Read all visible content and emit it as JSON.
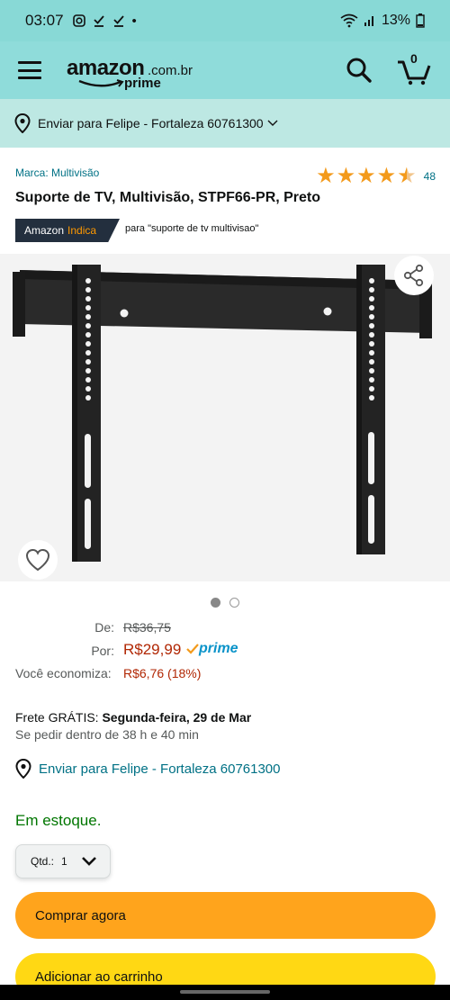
{
  "status_bar": {
    "time": "03:07",
    "icons": [
      "instagram-icon",
      "download-done-icon",
      "download-done-icon",
      "dot"
    ],
    "battery": "13%"
  },
  "header": {
    "logo_word": "amazon",
    "logo_tld": ".com.br",
    "logo_prime": "prime",
    "cart_count": "0"
  },
  "delivery_bar": {
    "text": "Enviar para Felipe - Fortaleza 60761300"
  },
  "product": {
    "brand": "Marca: Multivisão",
    "rating_value": 4.5,
    "rating_count": "48",
    "title": "Suporte de TV, Multivisão, STPF66-PR, Preto",
    "badge_amazon": "Amazon",
    "badge_indica": "Indica",
    "badge_query": "para \"suporte de tv multivisao\"",
    "carousel_total": 2,
    "carousel_active": 1
  },
  "pricing": {
    "de_label": "De:",
    "de_value": "R$36,75",
    "por_label": "Por:",
    "por_value": "R$29,99",
    "prime_label": "prime",
    "save_label": "Você economiza:",
    "save_value": "R$6,76 (18%)"
  },
  "delivery": {
    "frete_prefix": "Frete GRÁTIS:",
    "frete_date": "Segunda-feira, 29 de Mar",
    "pedir": "Se pedir dentro de 38 h e 40 min",
    "ship_to": "Enviar para Felipe - Fortaleza 60761300"
  },
  "stock": "Em estoque.",
  "quantity": {
    "label": "Qtd.:",
    "value": "1"
  },
  "buttons": {
    "buy_now": "Comprar agora",
    "add_to_cart": "Adicionar ao carrinho"
  },
  "colors": {
    "header_bg": "#8fdcda",
    "delivery_bg": "#bde8e3",
    "link": "#007185",
    "price": "#b12704",
    "stock": "#007600",
    "buy_now": "#ffa41c",
    "add_to_cart": "#ffd814",
    "star": "#f39a1b"
  }
}
